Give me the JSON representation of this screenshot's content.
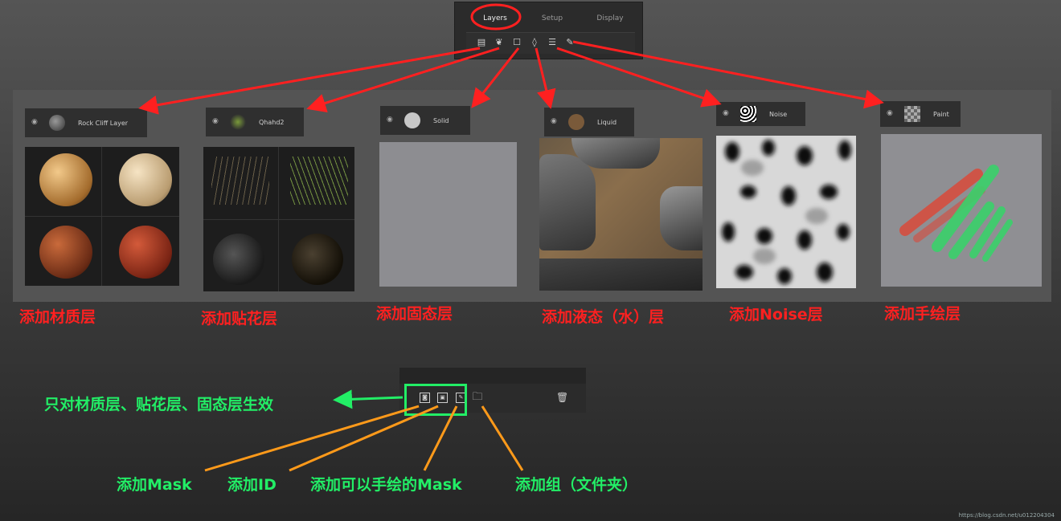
{
  "top_panel": {
    "tabs": [
      "Layers",
      "Setup",
      "Display"
    ],
    "tool_icons": [
      "fill-layer-icon",
      "decal-icon",
      "solid-icon",
      "liquid-icon",
      "noise-icon",
      "paint-brush-icon"
    ]
  },
  "layer_types": [
    {
      "name": "Rock Cliff Layer",
      "caption": "添加材质层"
    },
    {
      "name": "Qhahd2",
      "caption": "添加贴花层"
    },
    {
      "name": "Solid",
      "caption": "添加固态层"
    },
    {
      "name": "Liquid",
      "caption": "添加液态（水）层"
    },
    {
      "name": "Noise",
      "caption": "添加Noise层"
    },
    {
      "name": "Paint",
      "caption": "添加手绘层"
    }
  ],
  "bottom_panel": {
    "group_note": "只对材质层、贴花层、固态层生效",
    "labels": {
      "mask": "添加Mask",
      "id": "添加ID",
      "paint_mask": "添加可以手绘的Mask",
      "group": "添加组（文件夹）"
    }
  },
  "colors": {
    "red_annotation": "#ff2020",
    "green_annotation": "#22ee66",
    "orange_arrow": "#ff9a1a"
  },
  "watermark": "https://blog.csdn.net/u012204304"
}
